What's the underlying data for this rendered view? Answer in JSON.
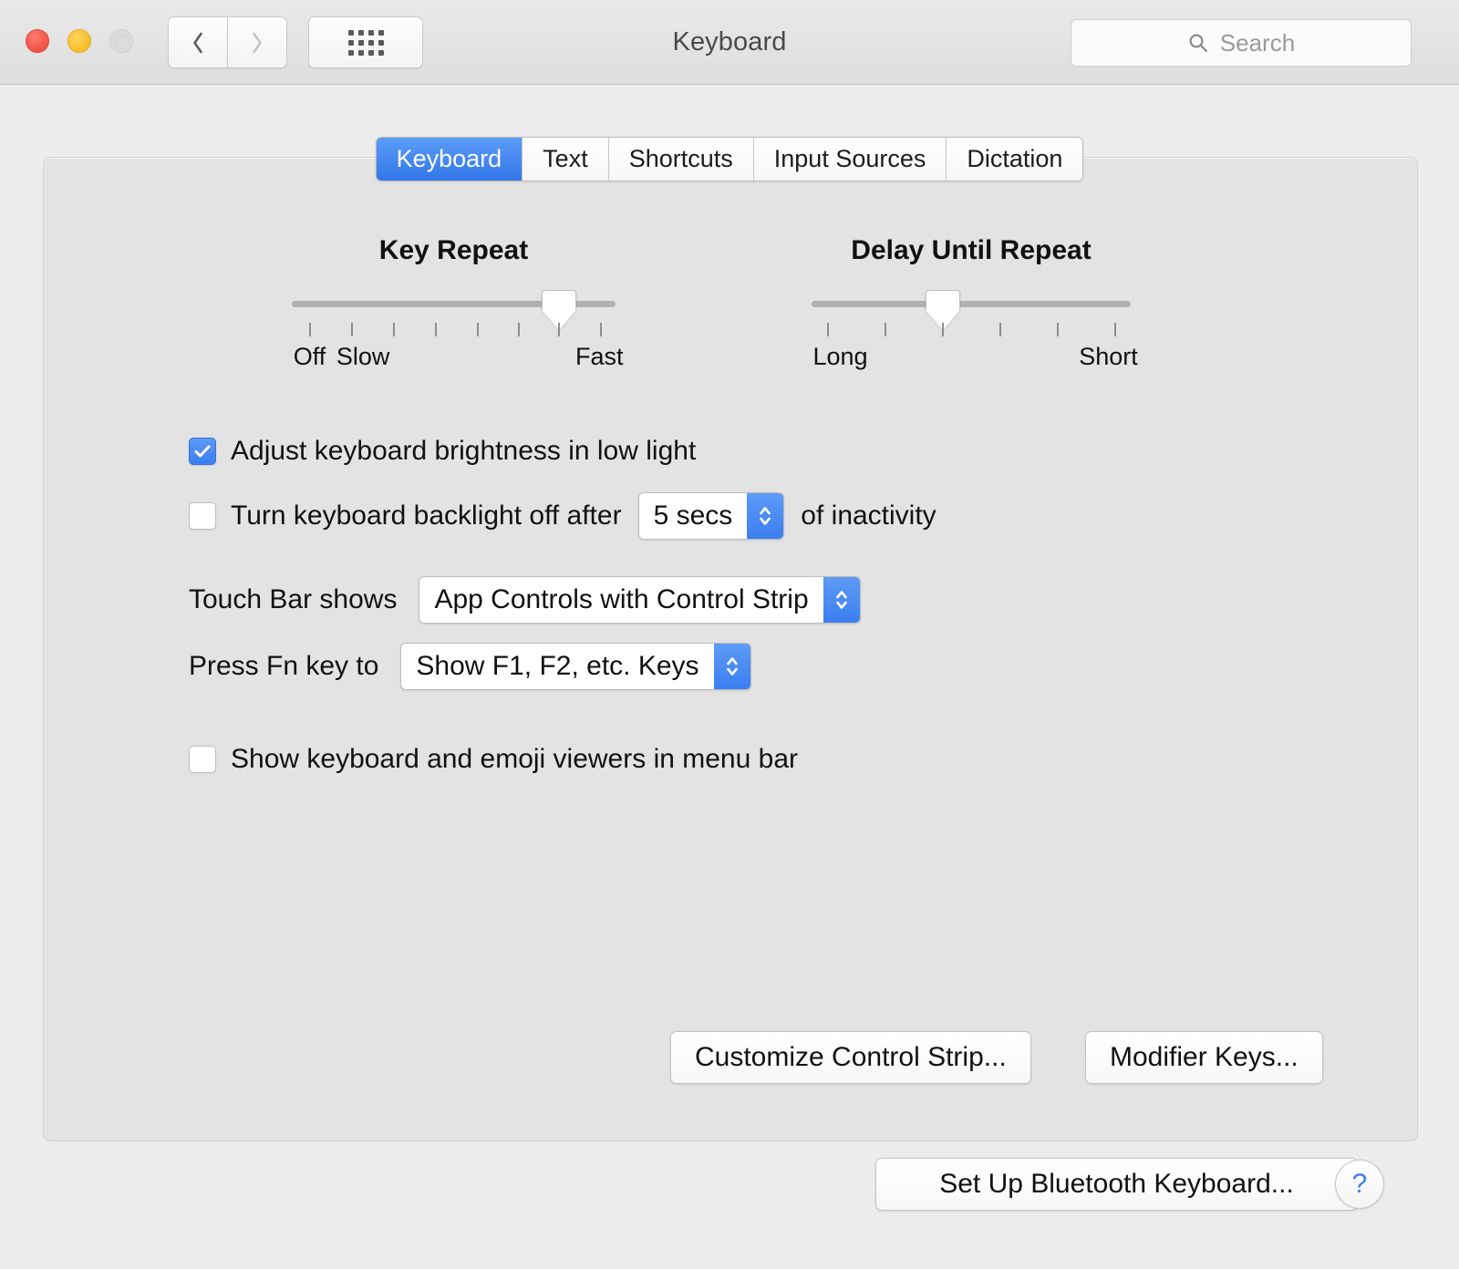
{
  "window": {
    "title": "Keyboard",
    "traffic_lights": [
      "close",
      "minimize",
      "zoom"
    ],
    "nav": {
      "back": "back-chevron",
      "forward": "forward-chevron"
    },
    "show_all": "grid-icon",
    "search": {
      "placeholder": "Search",
      "value": "",
      "icon": "search-icon"
    }
  },
  "tabs": [
    {
      "label": "Keyboard",
      "active": true
    },
    {
      "label": "Text",
      "active": false
    },
    {
      "label": "Shortcuts",
      "active": false
    },
    {
      "label": "Input Sources",
      "active": false
    },
    {
      "label": "Dictation",
      "active": false
    }
  ],
  "sliders": {
    "key_repeat": {
      "title": "Key Repeat",
      "ticks": 8,
      "value_tick": 7,
      "labels": [
        {
          "text": "Off",
          "tick": 1
        },
        {
          "text": "Slow",
          "tick": 2
        },
        {
          "text": "Fast",
          "tick": 8
        }
      ]
    },
    "delay_until_repeat": {
      "title": "Delay Until Repeat",
      "ticks": 6,
      "value_tick": 3,
      "labels": [
        {
          "text": "Long",
          "tick": 1
        },
        {
          "text": "Short",
          "tick": 6
        }
      ]
    }
  },
  "options": {
    "adjust_brightness": {
      "label": "Adjust keyboard brightness in low light",
      "checked": true
    },
    "backlight_off": {
      "label": "Turn keyboard backlight off after",
      "checked": false,
      "value": "5 secs",
      "suffix": "of inactivity"
    },
    "show_viewers": {
      "label": "Show keyboard and emoji viewers in menu bar",
      "checked": false
    }
  },
  "popups": {
    "touch_bar": {
      "label": "Touch Bar shows",
      "value": "App Controls with Control Strip"
    },
    "fn_key": {
      "label": "Press Fn key to",
      "value": "Show F1, F2, etc. Keys"
    }
  },
  "buttons": {
    "customize_control_strip": "Customize Control Strip...",
    "modifier_keys": "Modifier Keys...",
    "set_up_bluetooth_keyboard": "Set Up Bluetooth Keyboard...",
    "help": "?"
  },
  "colors": {
    "accent_blue": "#3b7ef0",
    "window_bg": "#ececec",
    "panel_bg": "#e3e3e3"
  }
}
